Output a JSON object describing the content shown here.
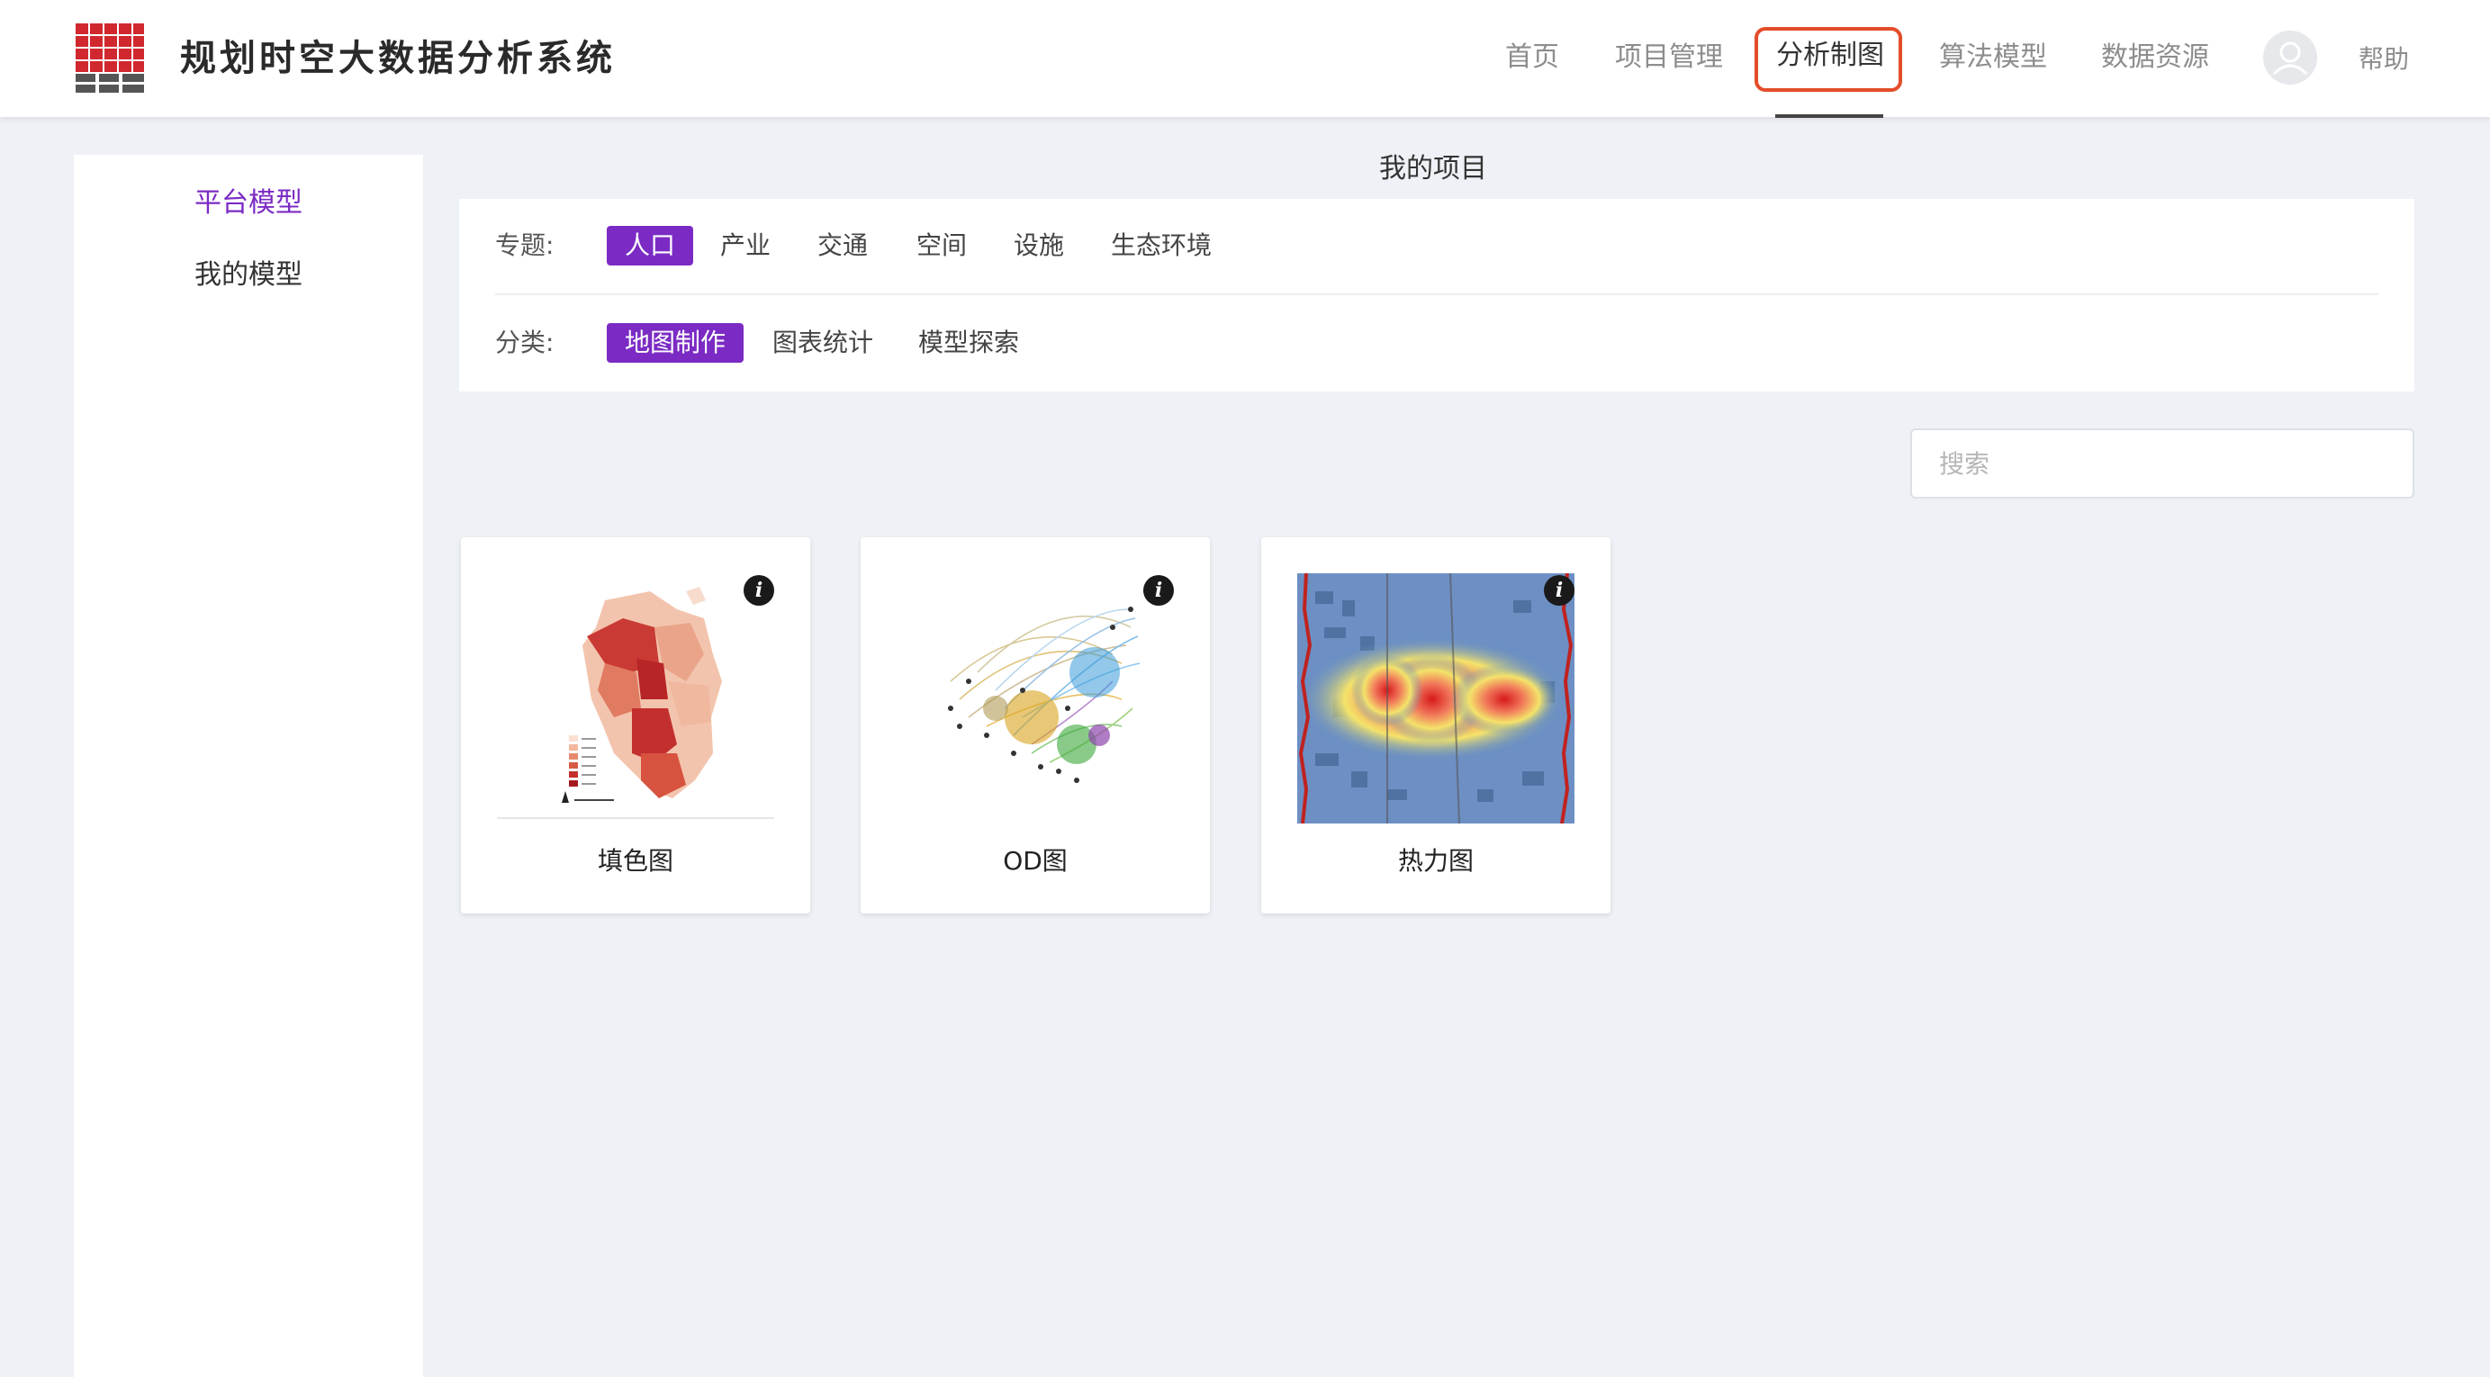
{
  "app": {
    "title": "规划时空大数据分析系统"
  },
  "nav": {
    "items": [
      {
        "label": "首页"
      },
      {
        "label": "项目管理"
      },
      {
        "label": "分析制图",
        "active": true
      },
      {
        "label": "算法模型"
      },
      {
        "label": "数据资源"
      }
    ],
    "help_label": "帮助",
    "avatar_icon": "user-avatar-icon"
  },
  "sidebar": {
    "items": [
      {
        "label": "平台模型",
        "active": true
      },
      {
        "label": "我的模型"
      }
    ]
  },
  "main": {
    "title": "我的项目",
    "topic": {
      "label": "专题:",
      "options": [
        "人口",
        "产业",
        "交通",
        "空间",
        "设施",
        "生态环境"
      ],
      "selected": "人口"
    },
    "category": {
      "label": "分类:",
      "options": [
        "地图制作",
        "图表统计",
        "模型探索"
      ],
      "selected": "地图制作"
    },
    "search": {
      "placeholder": "搜索"
    },
    "cards": [
      {
        "label": "填色图",
        "thumbnail": "choropleth-map-thumbnail"
      },
      {
        "label": "OD图",
        "thumbnail": "od-flow-map-thumbnail"
      },
      {
        "label": "热力图",
        "thumbnail": "heat-map-thumbnail"
      }
    ],
    "info_icon_glyph": "i"
  },
  "colors": {
    "accent": "#7b2bc4",
    "nav_highlight_border": "#e44d2a",
    "logo_red": "#d0282e",
    "logo_gray": "#555555"
  }
}
